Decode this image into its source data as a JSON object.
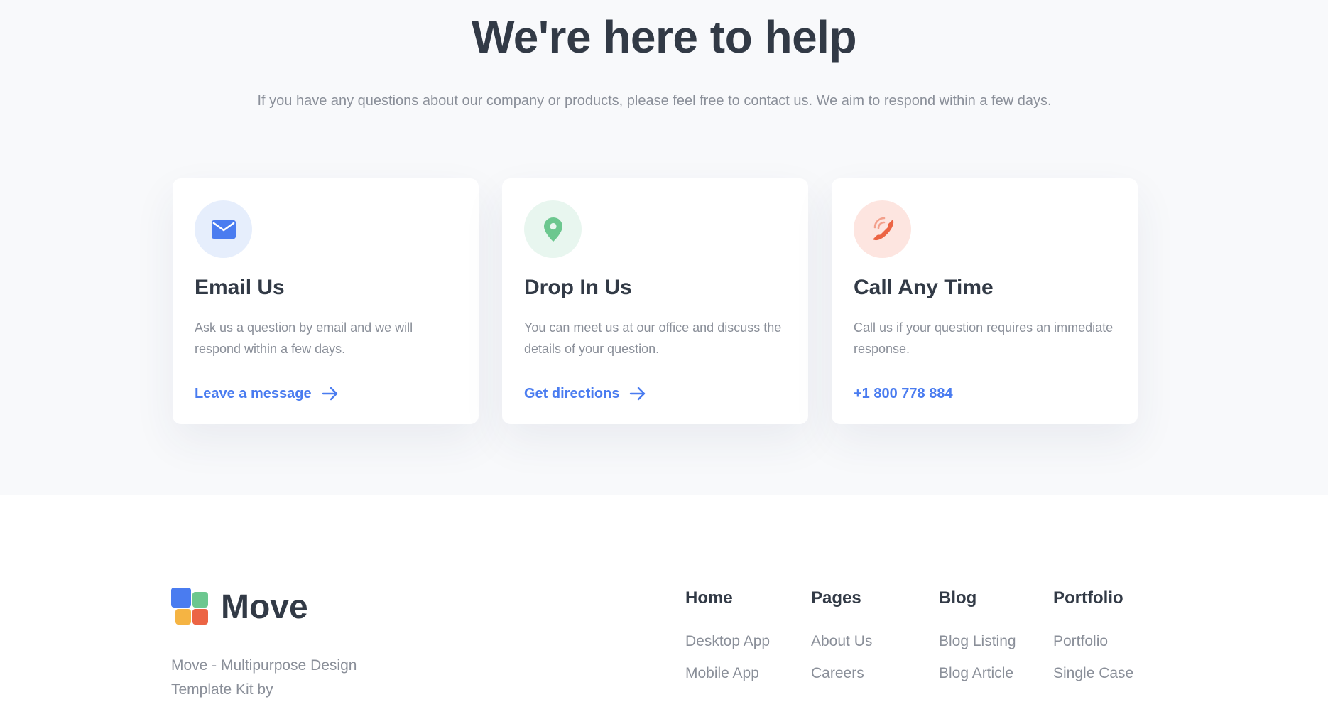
{
  "help": {
    "title": "We're here to help",
    "subtitle": "If you have any questions about our company or products, please feel free to contact us. We aim to respond within a few days."
  },
  "cards": [
    {
      "icon": "envelope-icon",
      "icon_color": "#4a7cf0",
      "title": "Email Us",
      "text": "Ask us a question by email and we will respond within a few days.",
      "link": "Leave a message"
    },
    {
      "icon": "location-pin-icon",
      "icon_color": "#6cc78f",
      "title": "Drop In Us",
      "text": "You can meet us at our office and discuss the details of your question.",
      "link": "Get directions"
    },
    {
      "icon": "phone-ringing-icon",
      "icon_color": "#ec6444",
      "title": "Call Any Time",
      "text": "Call us if your question requires an immediate response.",
      "link": "+1 800 778 884"
    }
  ],
  "footer": {
    "brand": "Move",
    "logo_colors": [
      "#4a7cf0",
      "#6cc78f",
      "#f5b443",
      "#ec6444"
    ],
    "description": "Move - Multipurpose Design Template Kit by",
    "columns": [
      {
        "heading": "Home",
        "links": [
          "Desktop App",
          "Mobile App"
        ]
      },
      {
        "heading": "Pages",
        "links": [
          "About Us",
          "Careers"
        ]
      },
      {
        "heading": "Blog",
        "links": [
          "Blog Listing",
          "Blog Article"
        ]
      },
      {
        "heading": "Portfolio",
        "links": [
          "Portfolio",
          "Single Case"
        ]
      }
    ]
  },
  "colors": {
    "accent": "#4a7cf0",
    "heading": "#323a46",
    "muted": "#8a8f99",
    "section_bg": "#f8f9fb"
  }
}
